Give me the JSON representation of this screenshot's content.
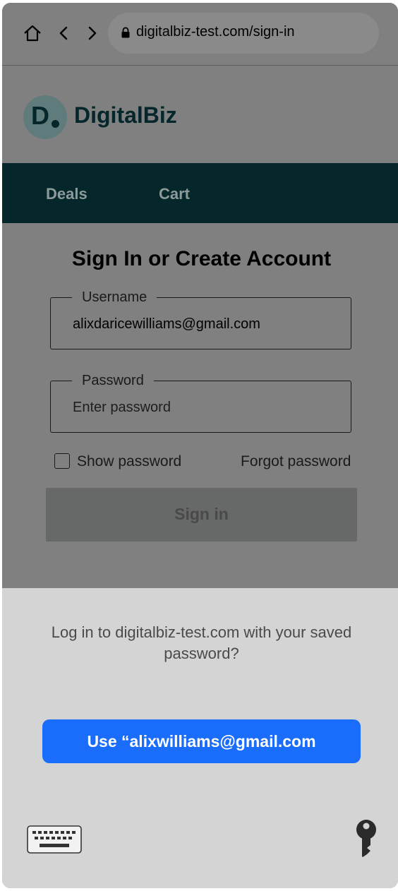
{
  "browser": {
    "url": "digitalbiz-test.com/sign-in",
    "icons": [
      "home-icon",
      "back-icon",
      "forward-icon",
      "lock-icon"
    ]
  },
  "site": {
    "logo_letter": "D",
    "brand_name": "DigitalBiz",
    "nav": {
      "deals": "Deals",
      "cart": "Cart"
    }
  },
  "form": {
    "title": "Sign In or Create Account",
    "username_label": "Username",
    "username_value": "alixdaricewilliams@gmail.com",
    "password_label": "Password",
    "password_placeholder": "Enter password",
    "show_password_label": "Show password",
    "show_password_checked": false,
    "forgot_password_label": "Forgot password",
    "submit_label": "Sign in"
  },
  "password_sheet": {
    "prompt": "Log in to digitalbiz-test.com with your saved password?",
    "use_button_label": "Use “alixwilliams@gmail.com",
    "icons": [
      "keyboard-icon",
      "key-icon"
    ]
  },
  "colors": {
    "brand_dark": "#05262a",
    "primary_button": "#1a6dfa",
    "overlay_gray": "#808080",
    "sheet_bg": "#d4d4d4"
  }
}
